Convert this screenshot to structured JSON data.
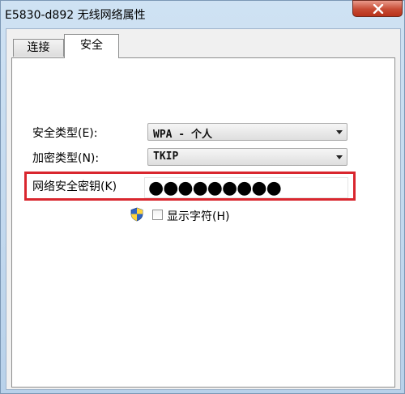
{
  "window": {
    "title": "E5830-d892 无线网络属性"
  },
  "tabs": [
    {
      "label": "连接"
    },
    {
      "label": "安全"
    }
  ],
  "security": {
    "type_label": "安全类型(E):",
    "type_value": "WPA - 个人",
    "encryption_label": "加密类型(N):",
    "encryption_value": "TKIP",
    "key_label": "网络安全密钥(K)",
    "key_value": "●●●●●●●●●",
    "show_chars_label": "显示字符(H)"
  },
  "colors": {
    "highlight": "#d9262e",
    "close_button": "#c74b34"
  },
  "icons": [
    "close-icon",
    "uac-shield-icon",
    "dropdown-arrow-icon"
  ]
}
